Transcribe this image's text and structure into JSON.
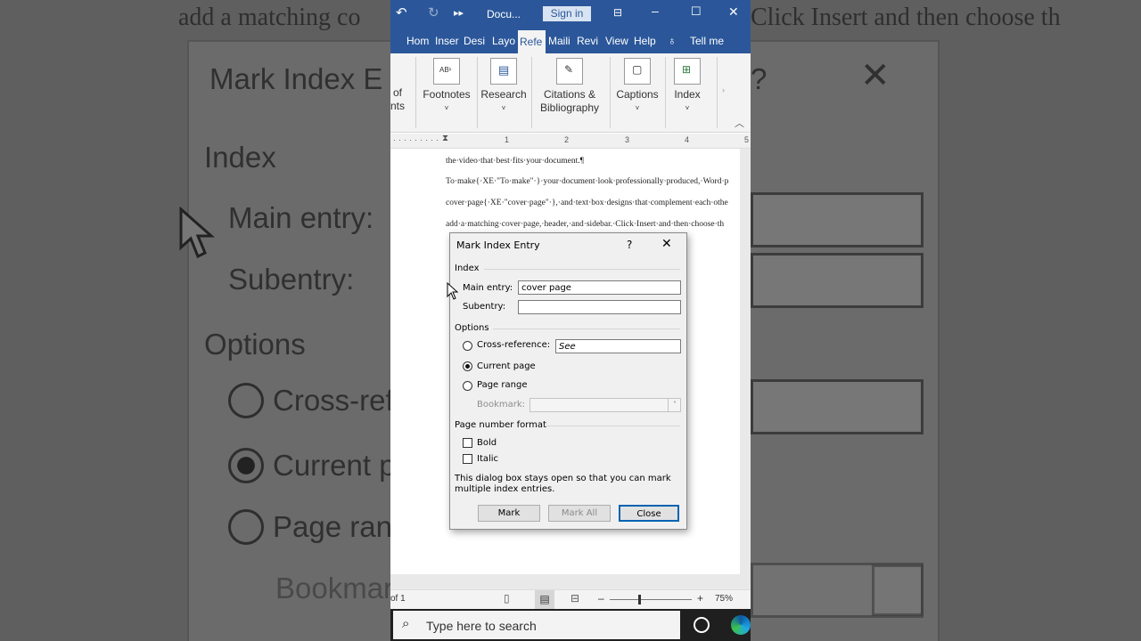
{
  "background": {
    "doc_line_top": "add a matching co",
    "doc_line_top_right": "Click Insert and then choose th",
    "dialog_title_partial": "Mark Index E",
    "help_glyph": "?",
    "index_label": "Index",
    "main_entry_partial": "Main entry:",
    "subentry_partial": "Subentry:",
    "options_label": "Options",
    "cross_ref_partial": "Cross-ref",
    "current_partial": "Current p",
    "page_range_partial": "Page ran",
    "bookmark_partial": "Bookmar"
  },
  "titlebar": {
    "doc_title": "Docu...",
    "sign_in": "Sign in"
  },
  "tabs": [
    "Hom",
    "Inser",
    "Desi",
    "Layo",
    "Refe",
    "Maili",
    "Revi",
    "View",
    "Help",
    "Tell me"
  ],
  "ribbon": {
    "toc_partial_1": "of",
    "toc_partial_2": "nts",
    "groups": [
      {
        "label1": "Footnotes",
        "label2": ""
      },
      {
        "label1": "Research",
        "label2": ""
      },
      {
        "label1": "Citations &",
        "label2": "Bibliography"
      },
      {
        "label1": "Captions",
        "label2": ""
      },
      {
        "label1": "Index",
        "label2": ""
      }
    ]
  },
  "ruler": [
    "1",
    "2",
    "3",
    "4",
    "5"
  ],
  "document": {
    "lines": [
      "the·video·that·best·fits·your·document.¶",
      "To·make{·XE·\"To·make\"·}·your·document·look·professionally·produced,·Word·p",
      "cover·page{·XE·\"cover·page\"·},·and·text·box·designs·that·complement·each·othe",
      "add·a·matching·cover·page,·header,·and·sidebar.·Click·Insert·and·then·choose·th"
    ]
  },
  "dialog": {
    "title": "Mark Index Entry",
    "help": "?",
    "section_index": "Index",
    "main_entry_label": "Main entry:",
    "main_entry_value": "cover page",
    "subentry_label": "Subentry:",
    "subentry_value": "",
    "section_options": "Options",
    "cross_reference_label": "Cross-reference:",
    "cross_reference_value": "See",
    "current_page_label": "Current page",
    "page_range_label": "Page range",
    "bookmark_label": "Bookmark:",
    "section_page_number_format": "Page number format",
    "bold_label": "Bold",
    "italic_label": "Italic",
    "note_line1": "This dialog box stays open so that you can mark",
    "note_line2": "multiple index entries.",
    "mark_button": "Mark",
    "mark_all_button": "Mark All",
    "close_button": "Close"
  },
  "status": {
    "page_info": "of 1",
    "zoom": "75%"
  },
  "taskbar": {
    "search_placeholder": "Type here to search"
  }
}
